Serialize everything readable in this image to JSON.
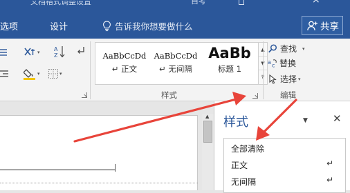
{
  "window": {
    "title": "文档格式调整设置",
    "account": "自考",
    "close_glyph": "×"
  },
  "tabs": {
    "left_partial": "选项",
    "design": "设计"
  },
  "tell_me": {
    "placeholder": "告诉我你想要做什么"
  },
  "share": {
    "label": "共享"
  },
  "ribbon": {
    "paragraph_dropdown_glyph": "▾",
    "styles": {
      "items": [
        {
          "preview": "AaBbCcDd",
          "name": "↵ 正文"
        },
        {
          "preview": "AaBbCcDd",
          "name": "↵ 无间隔"
        },
        {
          "preview": "AaBb",
          "name": "标题 1"
        }
      ],
      "scroll_glyphs": [
        "▲",
        "▼",
        "⊽"
      ],
      "group_label": "样式"
    },
    "editing": {
      "find": "查找",
      "replace": "替换",
      "select": "选择",
      "group_label": "编辑"
    }
  },
  "pane": {
    "title": "样式",
    "options_glyph": "▼",
    "close_glyph": "✕",
    "list": [
      {
        "label": "全部清除",
        "mark": ""
      },
      {
        "label": "正文",
        "mark": "↵"
      },
      {
        "label": "无间隔",
        "mark": "↵"
      }
    ]
  },
  "colors": {
    "accent": "#2b579a",
    "annotation": "#e8443a",
    "ribbon_bg": "#f3f3f3"
  }
}
